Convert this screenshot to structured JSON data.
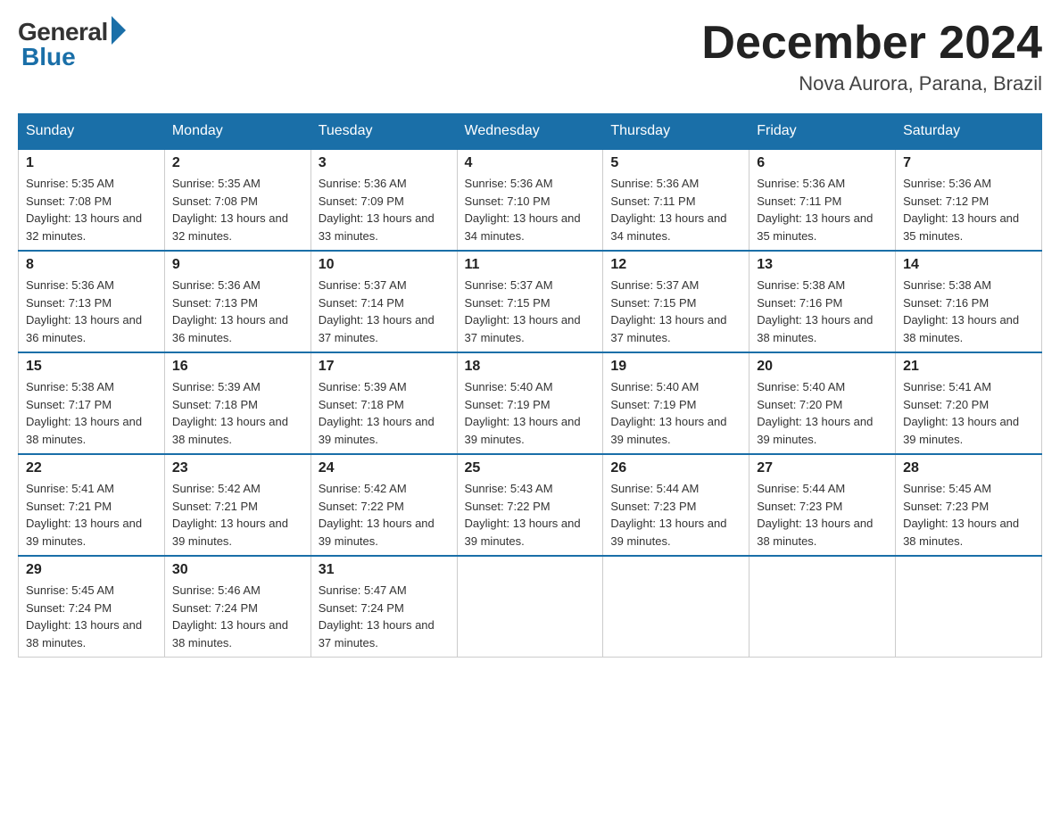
{
  "header": {
    "logo_general": "General",
    "logo_blue": "Blue",
    "month_title": "December 2024",
    "location": "Nova Aurora, Parana, Brazil"
  },
  "days_of_week": [
    "Sunday",
    "Monday",
    "Tuesday",
    "Wednesday",
    "Thursday",
    "Friday",
    "Saturday"
  ],
  "weeks": [
    [
      {
        "day": "1",
        "sunrise": "5:35 AM",
        "sunset": "7:08 PM",
        "daylight": "13 hours and 32 minutes."
      },
      {
        "day": "2",
        "sunrise": "5:35 AM",
        "sunset": "7:08 PM",
        "daylight": "13 hours and 32 minutes."
      },
      {
        "day": "3",
        "sunrise": "5:36 AM",
        "sunset": "7:09 PM",
        "daylight": "13 hours and 33 minutes."
      },
      {
        "day": "4",
        "sunrise": "5:36 AM",
        "sunset": "7:10 PM",
        "daylight": "13 hours and 34 minutes."
      },
      {
        "day": "5",
        "sunrise": "5:36 AM",
        "sunset": "7:11 PM",
        "daylight": "13 hours and 34 minutes."
      },
      {
        "day": "6",
        "sunrise": "5:36 AM",
        "sunset": "7:11 PM",
        "daylight": "13 hours and 35 minutes."
      },
      {
        "day": "7",
        "sunrise": "5:36 AM",
        "sunset": "7:12 PM",
        "daylight": "13 hours and 35 minutes."
      }
    ],
    [
      {
        "day": "8",
        "sunrise": "5:36 AM",
        "sunset": "7:13 PM",
        "daylight": "13 hours and 36 minutes."
      },
      {
        "day": "9",
        "sunrise": "5:36 AM",
        "sunset": "7:13 PM",
        "daylight": "13 hours and 36 minutes."
      },
      {
        "day": "10",
        "sunrise": "5:37 AM",
        "sunset": "7:14 PM",
        "daylight": "13 hours and 37 minutes."
      },
      {
        "day": "11",
        "sunrise": "5:37 AM",
        "sunset": "7:15 PM",
        "daylight": "13 hours and 37 minutes."
      },
      {
        "day": "12",
        "sunrise": "5:37 AM",
        "sunset": "7:15 PM",
        "daylight": "13 hours and 37 minutes."
      },
      {
        "day": "13",
        "sunrise": "5:38 AM",
        "sunset": "7:16 PM",
        "daylight": "13 hours and 38 minutes."
      },
      {
        "day": "14",
        "sunrise": "5:38 AM",
        "sunset": "7:16 PM",
        "daylight": "13 hours and 38 minutes."
      }
    ],
    [
      {
        "day": "15",
        "sunrise": "5:38 AM",
        "sunset": "7:17 PM",
        "daylight": "13 hours and 38 minutes."
      },
      {
        "day": "16",
        "sunrise": "5:39 AM",
        "sunset": "7:18 PM",
        "daylight": "13 hours and 38 minutes."
      },
      {
        "day": "17",
        "sunrise": "5:39 AM",
        "sunset": "7:18 PM",
        "daylight": "13 hours and 39 minutes."
      },
      {
        "day": "18",
        "sunrise": "5:40 AM",
        "sunset": "7:19 PM",
        "daylight": "13 hours and 39 minutes."
      },
      {
        "day": "19",
        "sunrise": "5:40 AM",
        "sunset": "7:19 PM",
        "daylight": "13 hours and 39 minutes."
      },
      {
        "day": "20",
        "sunrise": "5:40 AM",
        "sunset": "7:20 PM",
        "daylight": "13 hours and 39 minutes."
      },
      {
        "day": "21",
        "sunrise": "5:41 AM",
        "sunset": "7:20 PM",
        "daylight": "13 hours and 39 minutes."
      }
    ],
    [
      {
        "day": "22",
        "sunrise": "5:41 AM",
        "sunset": "7:21 PM",
        "daylight": "13 hours and 39 minutes."
      },
      {
        "day": "23",
        "sunrise": "5:42 AM",
        "sunset": "7:21 PM",
        "daylight": "13 hours and 39 minutes."
      },
      {
        "day": "24",
        "sunrise": "5:42 AM",
        "sunset": "7:22 PM",
        "daylight": "13 hours and 39 minutes."
      },
      {
        "day": "25",
        "sunrise": "5:43 AM",
        "sunset": "7:22 PM",
        "daylight": "13 hours and 39 minutes."
      },
      {
        "day": "26",
        "sunrise": "5:44 AM",
        "sunset": "7:23 PM",
        "daylight": "13 hours and 39 minutes."
      },
      {
        "day": "27",
        "sunrise": "5:44 AM",
        "sunset": "7:23 PM",
        "daylight": "13 hours and 38 minutes."
      },
      {
        "day": "28",
        "sunrise": "5:45 AM",
        "sunset": "7:23 PM",
        "daylight": "13 hours and 38 minutes."
      }
    ],
    [
      {
        "day": "29",
        "sunrise": "5:45 AM",
        "sunset": "7:24 PM",
        "daylight": "13 hours and 38 minutes."
      },
      {
        "day": "30",
        "sunrise": "5:46 AM",
        "sunset": "7:24 PM",
        "daylight": "13 hours and 38 minutes."
      },
      {
        "day": "31",
        "sunrise": "5:47 AM",
        "sunset": "7:24 PM",
        "daylight": "13 hours and 37 minutes."
      },
      null,
      null,
      null,
      null
    ]
  ]
}
